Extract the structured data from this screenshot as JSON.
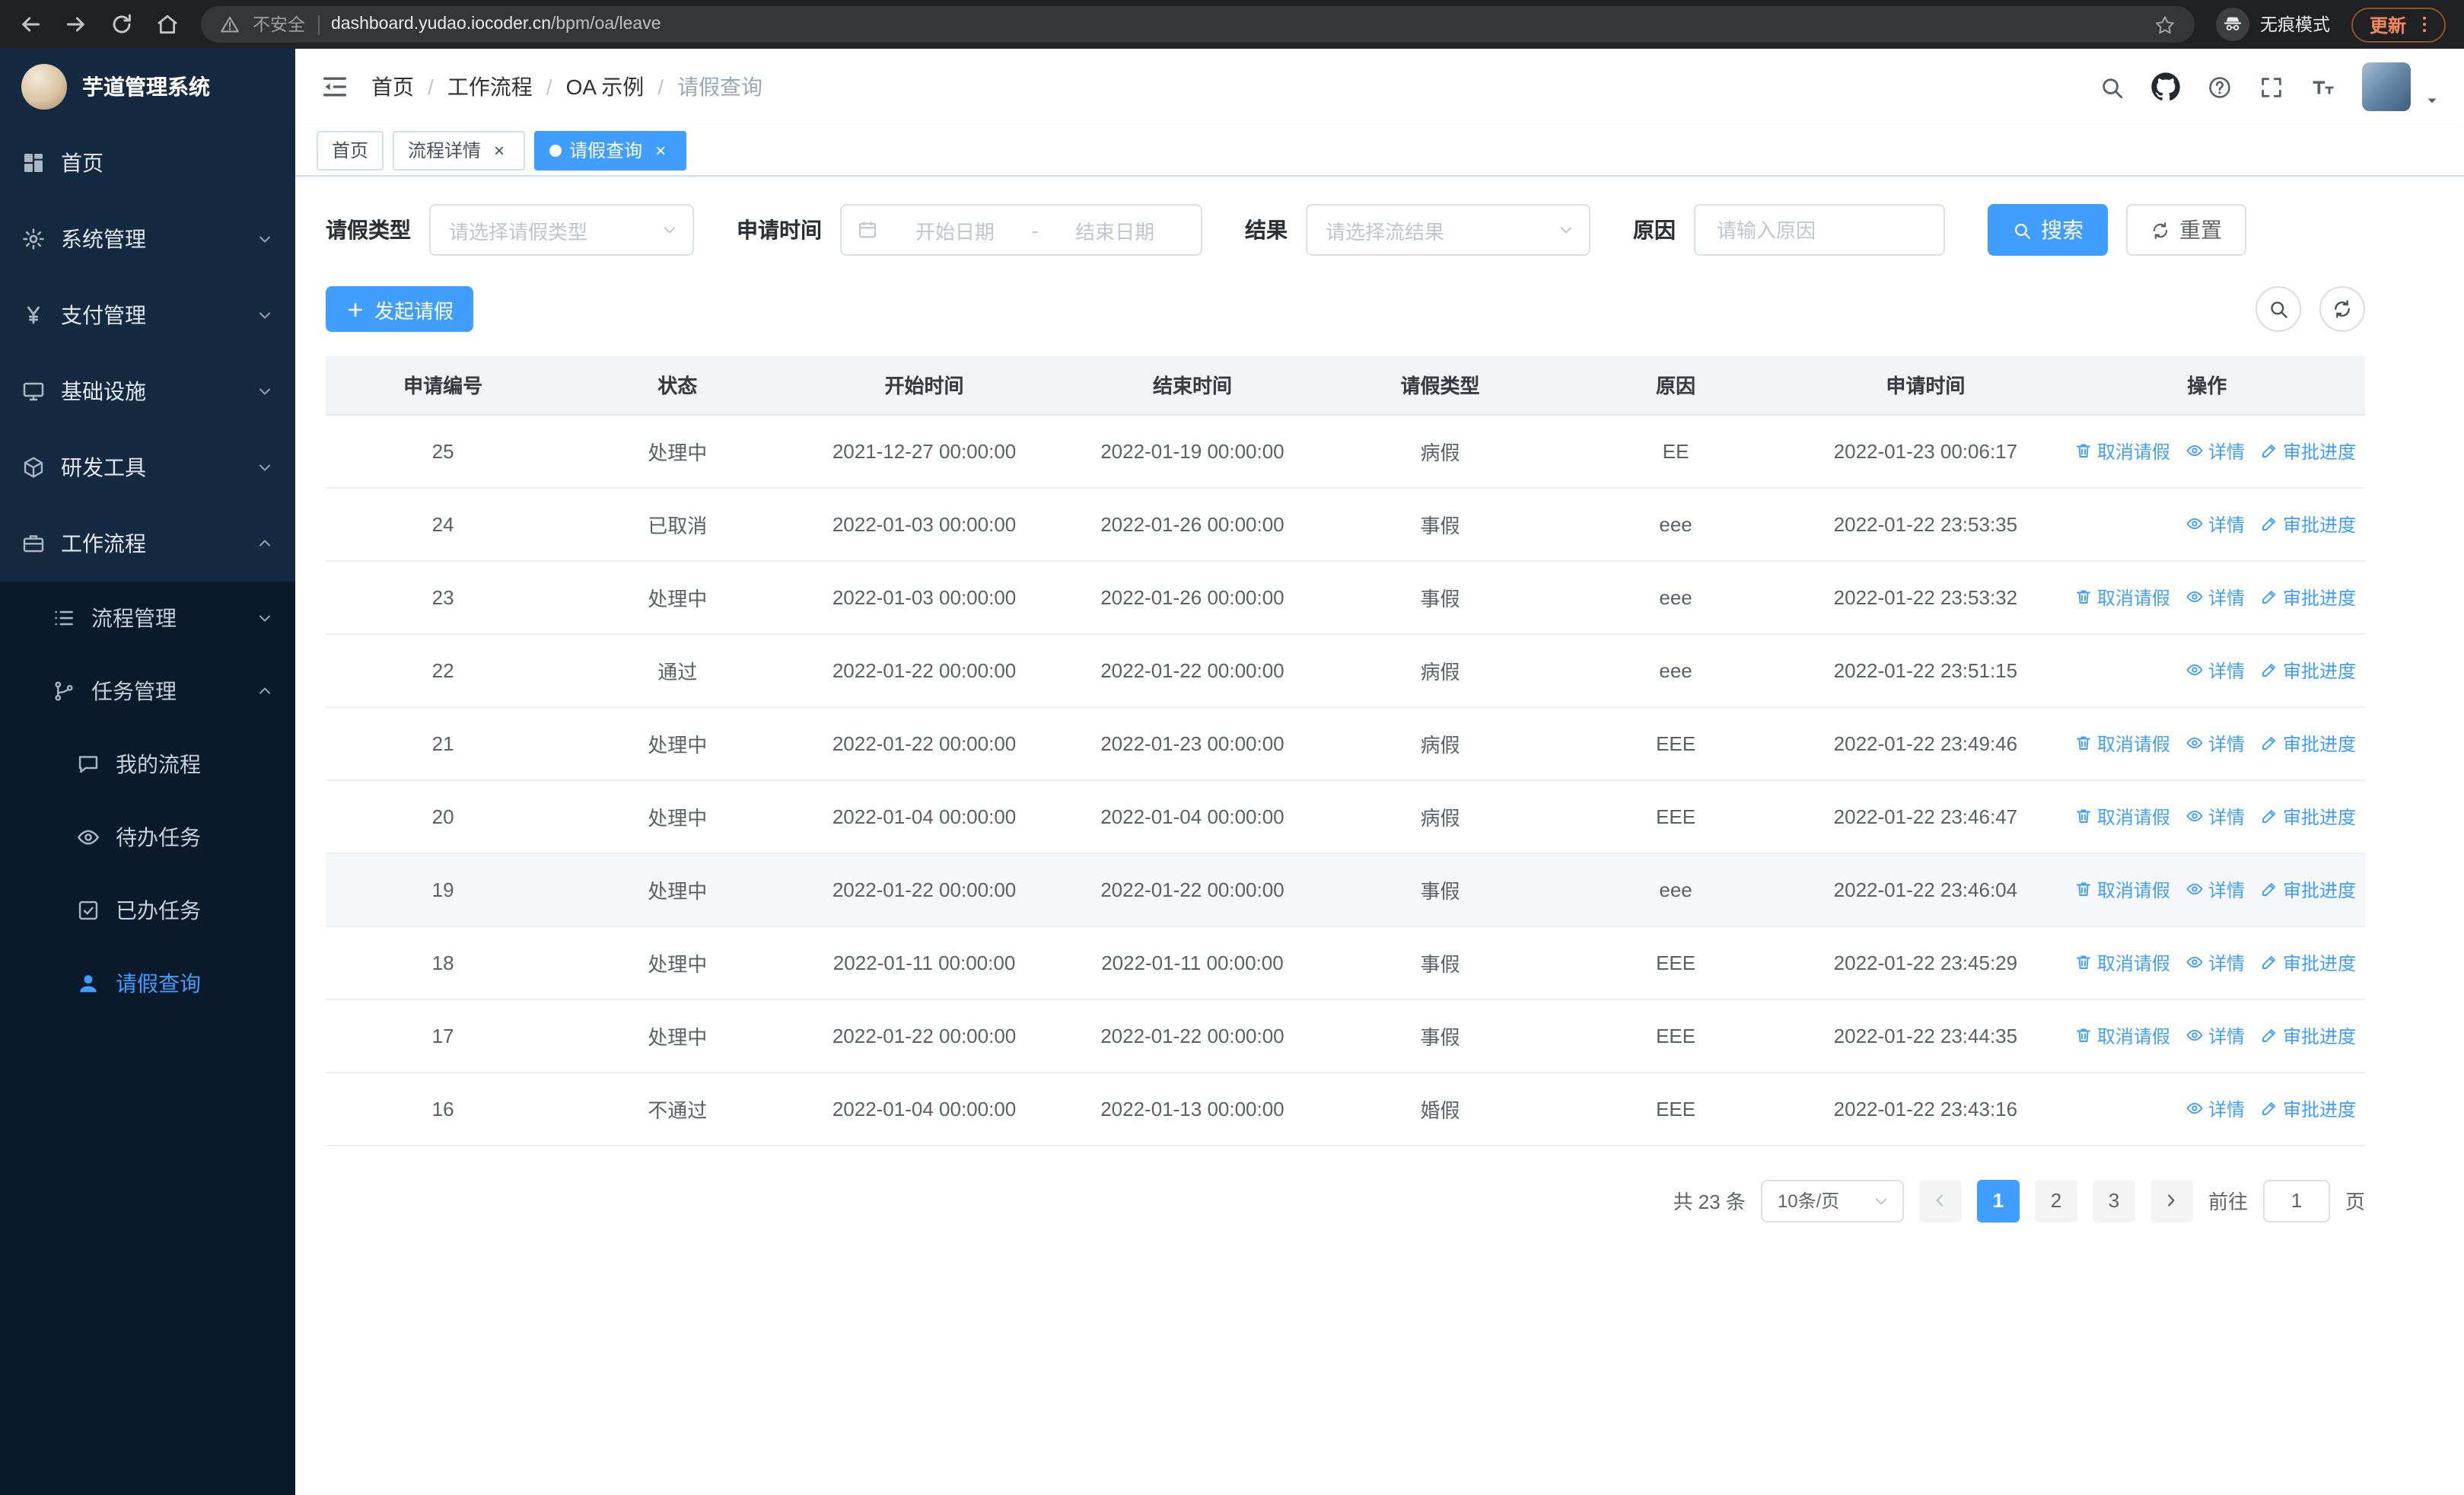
{
  "browser": {
    "security_label": "不安全",
    "url_domain": "dashboard.yudao.iocoder.cn",
    "url_path": "/bpm/oa/leave",
    "incognito_label": "无痕模式",
    "update_label": "更新"
  },
  "sidebar": {
    "title": "芋道管理系统",
    "items": [
      {
        "key": "home",
        "label": "首页",
        "icon": "dashboard-icon",
        "level": 1,
        "chevron": null,
        "active": false
      },
      {
        "key": "system-management",
        "label": "系统管理",
        "icon": "gear-icon",
        "level": 1,
        "chevron": "down",
        "active": false
      },
      {
        "key": "payment-management",
        "label": "支付管理",
        "icon": "yen-icon",
        "level": 1,
        "chevron": "down",
        "active": false
      },
      {
        "key": "infrastructure",
        "label": "基础设施",
        "icon": "monitor-icon",
        "level": 1,
        "chevron": "down",
        "active": false
      },
      {
        "key": "dev-tools",
        "label": "研发工具",
        "icon": "cube-icon",
        "level": 1,
        "chevron": "down",
        "active": false
      },
      {
        "key": "workflow",
        "label": "工作流程",
        "icon": "briefcase-icon",
        "level": 1,
        "chevron": "up",
        "active": false
      },
      {
        "key": "process-management",
        "label": "流程管理",
        "icon": "list-icon",
        "level": 2,
        "chevron": "down",
        "active": false
      },
      {
        "key": "task-management",
        "label": "任务管理",
        "icon": "branch-icon",
        "level": 2,
        "chevron": "up",
        "active": false
      },
      {
        "key": "my-process",
        "label": "我的流程",
        "icon": "chat-icon",
        "level": 3,
        "chevron": null,
        "active": false
      },
      {
        "key": "todo-tasks",
        "label": "待办任务",
        "icon": "eye-icon",
        "level": 3,
        "chevron": null,
        "active": false
      },
      {
        "key": "done-tasks",
        "label": "已办任务",
        "icon": "check-square-icon",
        "level": 3,
        "chevron": null,
        "active": false
      },
      {
        "key": "leave-query",
        "label": "请假查询",
        "icon": "user-icon",
        "level": 3,
        "chevron": null,
        "active": true
      }
    ]
  },
  "header": {
    "breadcrumb": [
      "首页",
      "工作流程",
      "OA 示例",
      "请假查询"
    ],
    "action_icons": [
      "search-icon",
      "github-icon",
      "help-icon",
      "fullscreen-icon",
      "font-size-icon"
    ]
  },
  "tabs": [
    {
      "key": "home",
      "label": "首页",
      "closable": false,
      "active": false
    },
    {
      "key": "process-detail",
      "label": "流程详情",
      "closable": true,
      "active": false
    },
    {
      "key": "leave-query",
      "label": "请假查询",
      "closable": true,
      "active": true
    }
  ],
  "filters": {
    "type_label": "请假类型",
    "type_placeholder": "请选择请假类型",
    "time_label": "申请时间",
    "start_placeholder": "开始日期",
    "range_separator": "-",
    "end_placeholder": "结束日期",
    "result_label": "结果",
    "result_placeholder": "请选择流结果",
    "reason_label": "原因",
    "reason_placeholder": "请输入原因",
    "search_label": "搜索",
    "reset_label": "重置"
  },
  "toolbar": {
    "create_label": "发起请假"
  },
  "table": {
    "columns": [
      "申请编号",
      "状态",
      "开始时间",
      "结束时间",
      "请假类型",
      "原因",
      "申请时间",
      "操作"
    ],
    "action_labels": {
      "cancel": {
        "label": "取消请假",
        "icon": "trash-icon"
      },
      "detail": {
        "label": "详情",
        "icon": "eye-icon"
      },
      "progress": {
        "label": "审批进度",
        "icon": "edit-icon"
      }
    },
    "rows": [
      {
        "id": "25",
        "status": "处理中",
        "start": "2021-12-27 00:00:00",
        "end": "2022-01-19 00:00:00",
        "type": "病假",
        "reason": "EE",
        "apply_time": "2022-01-23 00:06:17",
        "actions": [
          "cancel",
          "detail",
          "progress"
        ],
        "highlight": false
      },
      {
        "id": "24",
        "status": "已取消",
        "start": "2022-01-03 00:00:00",
        "end": "2022-01-26 00:00:00",
        "type": "事假",
        "reason": "eee",
        "apply_time": "2022-01-22 23:53:35",
        "actions": [
          "detail",
          "progress"
        ],
        "highlight": false
      },
      {
        "id": "23",
        "status": "处理中",
        "start": "2022-01-03 00:00:00",
        "end": "2022-01-26 00:00:00",
        "type": "事假",
        "reason": "eee",
        "apply_time": "2022-01-22 23:53:32",
        "actions": [
          "cancel",
          "detail",
          "progress"
        ],
        "highlight": false
      },
      {
        "id": "22",
        "status": "通过",
        "start": "2022-01-22 00:00:00",
        "end": "2022-01-22 00:00:00",
        "type": "病假",
        "reason": "eee",
        "apply_time": "2022-01-22 23:51:15",
        "actions": [
          "detail",
          "progress"
        ],
        "highlight": false
      },
      {
        "id": "21",
        "status": "处理中",
        "start": "2022-01-22 00:00:00",
        "end": "2022-01-23 00:00:00",
        "type": "病假",
        "reason": "EEE",
        "apply_time": "2022-01-22 23:49:46",
        "actions": [
          "cancel",
          "detail",
          "progress"
        ],
        "highlight": false
      },
      {
        "id": "20",
        "status": "处理中",
        "start": "2022-01-04 00:00:00",
        "end": "2022-01-04 00:00:00",
        "type": "病假",
        "reason": "EEE",
        "apply_time": "2022-01-22 23:46:47",
        "actions": [
          "cancel",
          "detail",
          "progress"
        ],
        "highlight": false
      },
      {
        "id": "19",
        "status": "处理中",
        "start": "2022-01-22 00:00:00",
        "end": "2022-01-22 00:00:00",
        "type": "事假",
        "reason": "eee",
        "apply_time": "2022-01-22 23:46:04",
        "actions": [
          "cancel",
          "detail",
          "progress"
        ],
        "highlight": true
      },
      {
        "id": "18",
        "status": "处理中",
        "start": "2022-01-11 00:00:00",
        "end": "2022-01-11 00:00:00",
        "type": "事假",
        "reason": "EEE",
        "apply_time": "2022-01-22 23:45:29",
        "actions": [
          "cancel",
          "detail",
          "progress"
        ],
        "highlight": false
      },
      {
        "id": "17",
        "status": "处理中",
        "start": "2022-01-22 00:00:00",
        "end": "2022-01-22 00:00:00",
        "type": "事假",
        "reason": "EEE",
        "apply_time": "2022-01-22 23:44:35",
        "actions": [
          "cancel",
          "detail",
          "progress"
        ],
        "highlight": false
      },
      {
        "id": "16",
        "status": "不通过",
        "start": "2022-01-04 00:00:00",
        "end": "2022-01-13 00:00:00",
        "type": "婚假",
        "reason": "EEE",
        "apply_time": "2022-01-22 23:43:16",
        "actions": [
          "detail",
          "progress"
        ],
        "highlight": false
      }
    ]
  },
  "pagination": {
    "total_label": "共 23 条",
    "page_size_label": "10条/页",
    "pages": [
      "1",
      "2",
      "3"
    ],
    "active_page": "1",
    "goto_label": "前往",
    "goto_value": "1",
    "page_unit_label": "页"
  },
  "colors": {
    "primary": "#409eff",
    "sidebar_bg": "#152a40",
    "submenu_bg": "#0b1b2b",
    "chrome_bg": "#202124",
    "update_accent": "#f0875a"
  },
  "icons": {
    "back-icon": "back",
    "forward-icon": "forward",
    "reload-icon": "reload",
    "home-icon": "home",
    "warning-icon": "warning",
    "bookmark-star-icon": "star",
    "incognito-icon": "incognito",
    "kebab-menu-icon": "kebab",
    "sidebar-toggle-icon": "hamburger",
    "search-icon": "search",
    "github-icon": "github",
    "help-icon": "question",
    "fullscreen-icon": "fullscreen",
    "font-size-icon": "fontsize",
    "caret-down-icon": "caretDown",
    "chevron-down-icon": "chevDown",
    "chevron-up-icon": "chevUp",
    "chevron-left-icon": "chevLeft",
    "chevron-right-icon": "chevRight",
    "calendar-icon": "calendar",
    "plus-icon": "plus",
    "refresh-icon": "refresh",
    "trash-icon": "trash",
    "eye-icon": "eye",
    "edit-icon": "edit",
    "dashboard-icon": "dashboard",
    "gear-icon": "gear",
    "yen-icon": "yen",
    "monitor-icon": "monitor",
    "cube-icon": "cube",
    "briefcase-icon": "briefcase",
    "list-icon": "list",
    "branch-icon": "branch",
    "chat-icon": "chat",
    "check-square-icon": "checkSq",
    "user-icon": "user"
  }
}
